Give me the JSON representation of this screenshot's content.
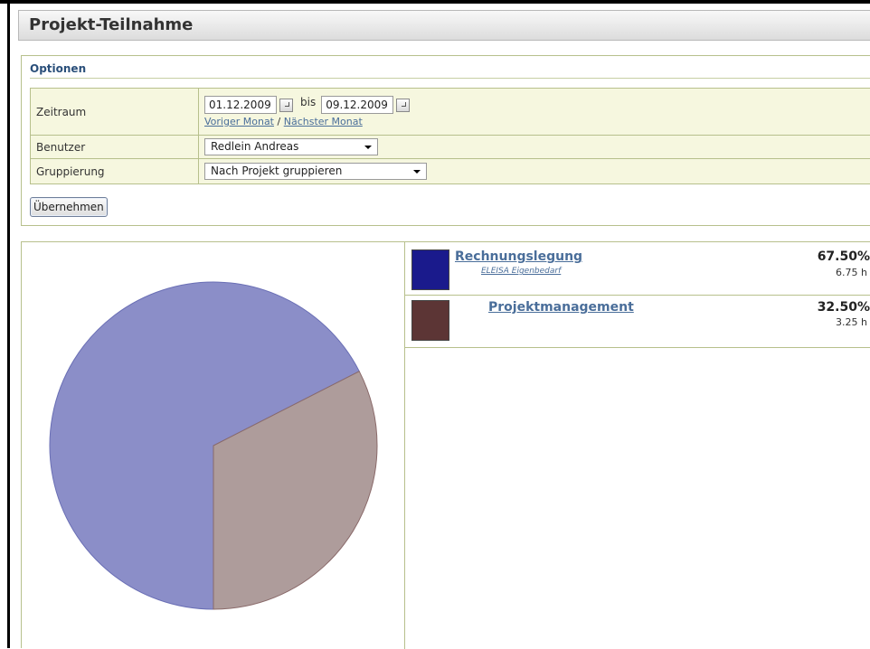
{
  "page": {
    "title": "Projekt-Teilnahme"
  },
  "options": {
    "title": "Optionen",
    "zeitraum": {
      "label": "Zeitraum",
      "from": "01.12.2009",
      "to": "09.12.2009",
      "separator": "bis",
      "prev_link": "Voriger Monat",
      "link_sep": "/",
      "next_link": "Nächster Monat"
    },
    "benutzer": {
      "label": "Benutzer",
      "value": "Redlein Andreas"
    },
    "gruppierung": {
      "label": "Gruppierung",
      "value": "Nach Projekt gruppieren"
    },
    "apply_label": "Übernehmen"
  },
  "legend": [
    {
      "name": "Rechnungslegung",
      "sub": "ELEISA Eigenbedarf",
      "percent": "67.50%",
      "hours": "6.75 h",
      "color": "#1a1a8c"
    },
    {
      "name": "Projektmanagement",
      "sub": "",
      "percent": "32.50%",
      "hours": "3.25 h",
      "color": "#5c3535"
    }
  ],
  "chart_data": {
    "type": "pie",
    "labels": [
      "Rechnungslegung",
      "Projektmanagement"
    ],
    "values": [
      67.5,
      32.5
    ],
    "hours": [
      6.75,
      3.25
    ],
    "colors": [
      "#8b8ec8",
      "#ae9c9b"
    ],
    "stroke_colors": [
      "#6a6fb5",
      "#8a6a6a"
    ]
  }
}
